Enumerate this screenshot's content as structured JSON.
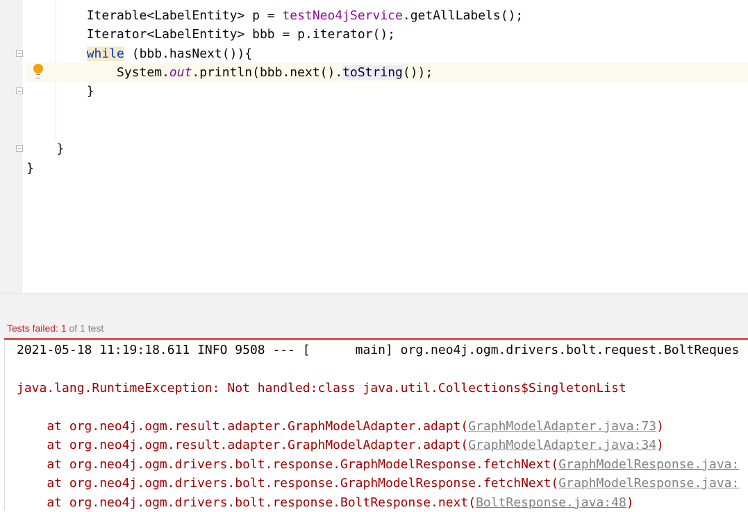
{
  "editor": {
    "lines": [
      {
        "indent": 2,
        "pre": "Iterable<LabelEntity> p = ",
        "field": "testNeo4jService",
        "post": ".getAllLabels();"
      },
      {
        "indent": 2,
        "text": "Iterator<LabelEntity> bbb = p.iterator();"
      },
      {
        "indent": 2,
        "keyword": "while",
        "text": " (bbb.hasNext()){"
      },
      {
        "indent": 3,
        "pre": "System.",
        "static": "out",
        "mid": ".println(bbb.next().",
        "highlight": "toString",
        "post": "());"
      },
      {
        "indent": 2,
        "text": "}"
      },
      {
        "indent": 1,
        "text": "}"
      },
      {
        "indent": 0,
        "text": "}"
      }
    ],
    "intention_icon": "lightbulb-icon"
  },
  "test_status": {
    "label": "Tests failed: ",
    "failed": "1",
    "rest": " of 1 test"
  },
  "console": {
    "info_line": "2021-05-18 11:19:18.611 INFO 9508 --- [      main] org.neo4j.ogm.drivers.bolt.request.BoltReques",
    "exception": "java.lang.RuntimeException: Not handled:class java.util.Collections$SingletonList",
    "stack": [
      {
        "prefix": "    at org.neo4j.ogm.result.adapter.GraphModelAdapter.adapt(",
        "link": "GraphModelAdapter.java:73",
        "suffix": ")"
      },
      {
        "prefix": "    at org.neo4j.ogm.result.adapter.GraphModelAdapter.adapt(",
        "link": "GraphModelAdapter.java:34",
        "suffix": ")"
      },
      {
        "prefix": "    at org.neo4j.ogm.drivers.bolt.response.GraphModelResponse.fetchNext(",
        "link": "GraphModelResponse.java:",
        "suffix": ""
      },
      {
        "prefix": "    at org.neo4j.ogm.drivers.bolt.response.GraphModelResponse.fetchNext(",
        "link": "GraphModelResponse.java:",
        "suffix": ""
      },
      {
        "prefix": "    at org.neo4j.ogm.drivers.bolt.response.BoltResponse.next(",
        "link": "BoltResponse.java:48",
        "suffix": ")"
      }
    ]
  },
  "colors": {
    "error": "#a00000",
    "status_red": "#c7222d",
    "keyword": "#0033b3",
    "field": "#871094"
  }
}
